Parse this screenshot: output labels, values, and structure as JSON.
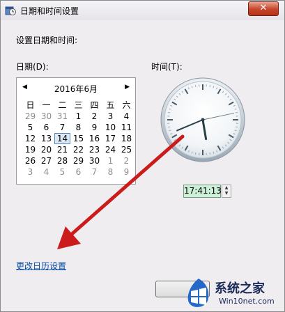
{
  "window": {
    "title": "日期和时间设置"
  },
  "titlebar": {
    "close_label": "✕"
  },
  "content": {
    "heading": "设置日期和时间:",
    "date_label": "日期(D):",
    "time_label": "时间(T):",
    "change_calendar_link": "更改日历设置"
  },
  "calendar": {
    "month": "2016年6月",
    "prev": "◀",
    "next": "▶",
    "weekdays": [
      "日",
      "一",
      "二",
      "三",
      "四",
      "五",
      "六"
    ],
    "weeks": [
      [
        "29",
        "30",
        "31",
        "1",
        "2",
        "3",
        "4"
      ],
      [
        "5",
        "6",
        "7",
        "8",
        "9",
        "10",
        "11"
      ],
      [
        "12",
        "13",
        "14",
        "15",
        "16",
        "17",
        "18"
      ],
      [
        "19",
        "20",
        "21",
        "22",
        "23",
        "24",
        "25"
      ],
      [
        "26",
        "27",
        "28",
        "29",
        "30",
        "1",
        "2"
      ],
      [
        "3",
        "4",
        "5",
        "6",
        "7",
        "8",
        "9"
      ]
    ],
    "selected_day": "14"
  },
  "clock": {
    "hour": 17,
    "minute": 41,
    "second": 13
  },
  "time_input": {
    "value": "17:41:13",
    "up": "▲",
    "down": "▼"
  },
  "watermark": {
    "brand": "系统之家",
    "url": "Win10net.com"
  },
  "colors": {
    "accent_arrow": "#cc1b1b",
    "time_field_bg": "#ccefd7",
    "link": "#0b4fa5"
  }
}
